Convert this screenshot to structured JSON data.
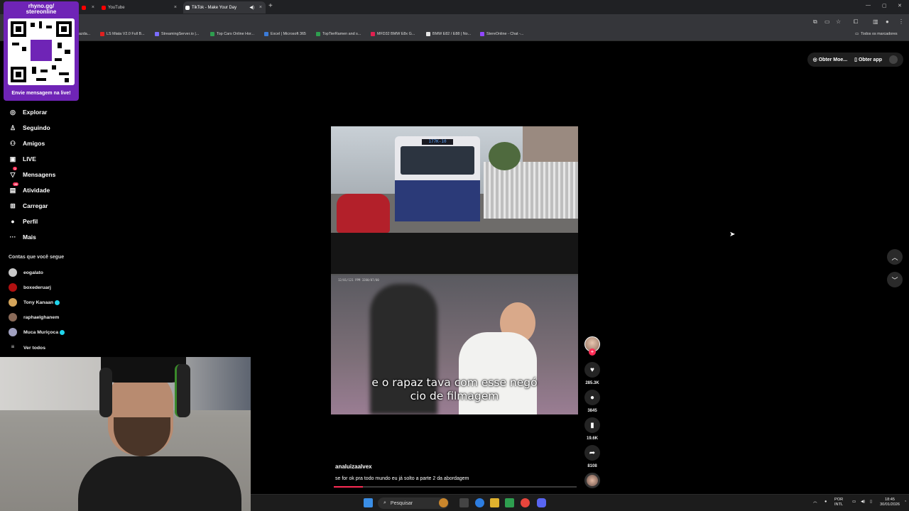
{
  "browser": {
    "tabs": [
      {
        "label": "",
        "color": "#ff0000"
      },
      {
        "label": "YouTube",
        "color": "#ff0000"
      },
      {
        "label": "TikTok - Make Your Day",
        "color": "#ffffff"
      }
    ],
    "bookmarks": [
      {
        "label": "azda...",
        "color": "#888888"
      },
      {
        "label": "LS Miata V2.0 Full B...",
        "color": "#e02020"
      },
      {
        "label": "StreamingServer.io |...",
        "color": "#7a6cff"
      },
      {
        "label": "Top Cars Online Hor...",
        "color": "#2e9e4f"
      },
      {
        "label": "Excel | Microsoft 365",
        "color": "#3b7bd8"
      },
      {
        "label": "TopTierRamen and s...",
        "color": "#2e9e4f"
      },
      {
        "label": "MFD32 BMW E8x G...",
        "color": "#e02050"
      },
      {
        "label": "BMW E82 / E88 | No...",
        "color": "#e6e6e6"
      },
      {
        "label": "StereOnline - Chat -...",
        "color": "#9147ff"
      }
    ],
    "all_bookmarks": "Todos os marcadores"
  },
  "overlay": {
    "title_line1": "rhyno.gg/",
    "title_line2": "stereonline",
    "caption": "Envie mensagem na live!"
  },
  "sidebar": {
    "nav": [
      {
        "label": "Explorar",
        "icon": "compass-icon",
        "glyph": "◎"
      },
      {
        "label": "Seguindo",
        "icon": "following-icon",
        "glyph": "⚇"
      },
      {
        "label": "Amigos",
        "icon": "friends-icon",
        "glyph": "⚇"
      },
      {
        "label": "LIVE",
        "icon": "live-icon",
        "glyph": "▣"
      },
      {
        "label": "Mensagens",
        "icon": "messages-icon",
        "glyph": "▽",
        "badge": "1"
      },
      {
        "label": "Atividade",
        "icon": "activity-icon",
        "glyph": "▤",
        "badge": "29"
      },
      {
        "label": "Carregar",
        "icon": "upload-icon",
        "glyph": "⊞"
      },
      {
        "label": "Perfil",
        "icon": "profile-icon",
        "glyph": "●"
      },
      {
        "label": "Mais",
        "icon": "more-icon",
        "glyph": "···"
      }
    ],
    "following_title": "Contas que você segue",
    "following": [
      {
        "name": "eogalato",
        "color": "#c8c8c8",
        "verified": false
      },
      {
        "name": "boxederuarj",
        "color": "#b01010",
        "verified": false
      },
      {
        "name": "Tony Kanaan",
        "color": "#d4a45a",
        "verified": true
      },
      {
        "name": "raphaelghanem",
        "color": "#8a6a58",
        "verified": false
      },
      {
        "name": "Muca Muriçoca",
        "color": "#a0a0c0",
        "verified": true
      }
    ],
    "see_all": "Ver todos"
  },
  "top_actions": {
    "coins": "Obter Moe...",
    "app": "Obter app"
  },
  "video": {
    "bus_sign": "177K-10",
    "caption_line1": "e o rapaz tava com esse negó",
    "caption_line2": "cio de filmagem",
    "timestamp": "12/01/121 PPM 3200/07/00",
    "author": "analuizaalvex",
    "description": "se for ok pra todo mundo eu já solto a parte 2 da abordagem",
    "progress": 0.12
  },
  "actions": {
    "likes": "285.3K",
    "comments": "3845",
    "saves": "19.6K",
    "shares": "8108"
  },
  "taskbar": {
    "search_placeholder": "Pesquisar",
    "lang_top": "POR",
    "lang_bottom": "INTL",
    "time": "18:45",
    "date": "30/01/2026"
  },
  "colors": {
    "accent": "#fe2c55",
    "overlay": "#6f24b6",
    "verified": "#20d5ec"
  }
}
